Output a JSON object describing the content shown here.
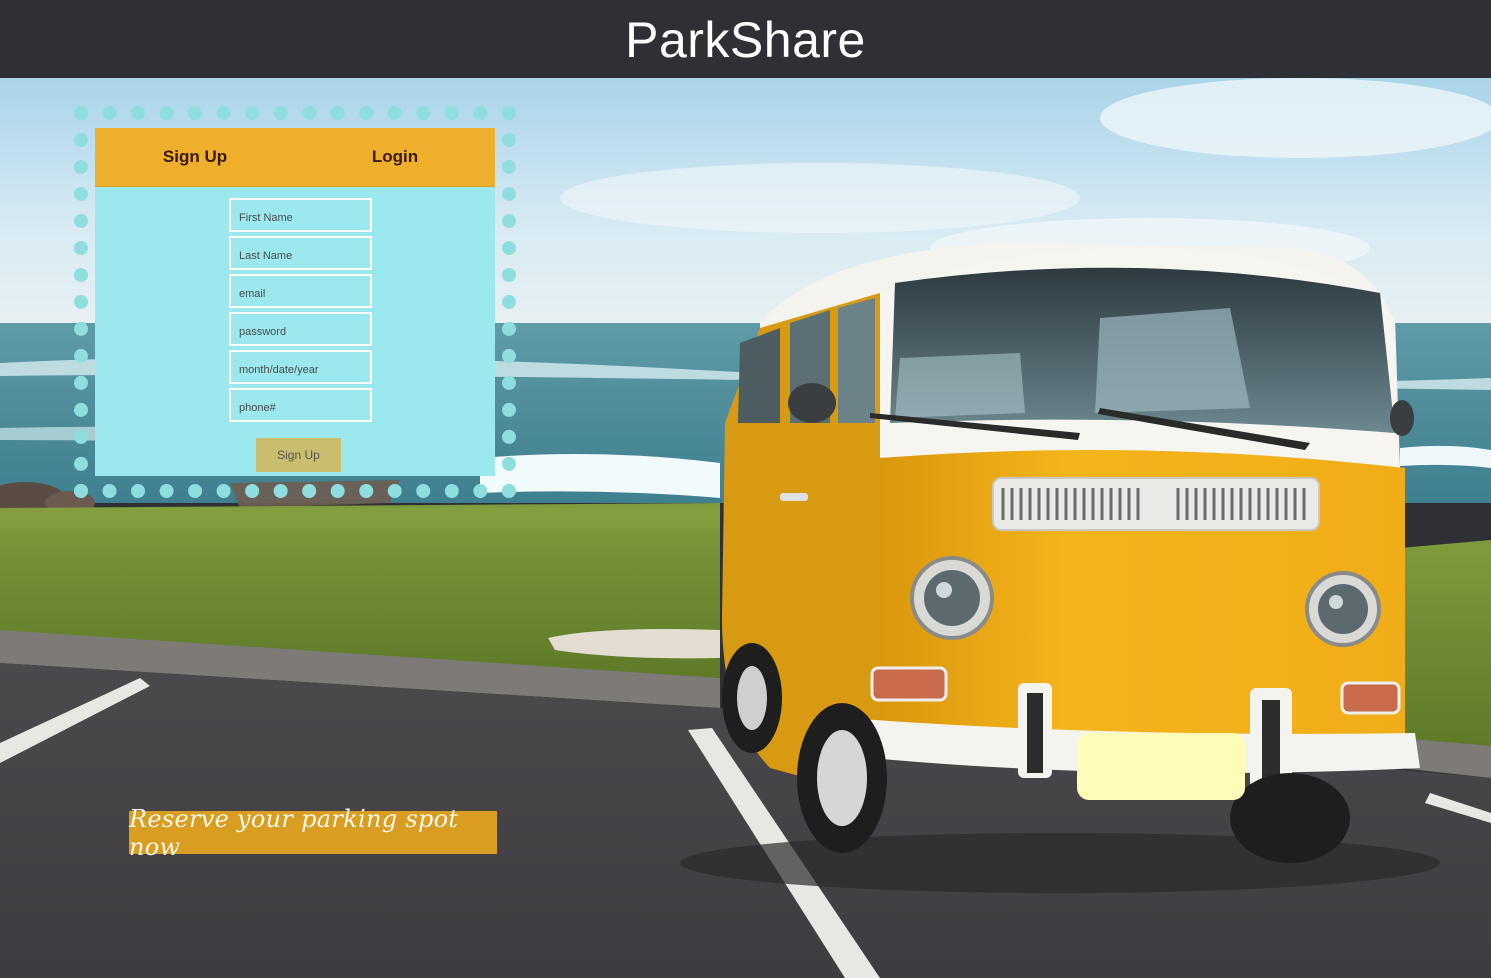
{
  "header": {
    "title": "ParkShare"
  },
  "auth": {
    "tabs": [
      {
        "label": "Sign Up"
      },
      {
        "label": "Login"
      }
    ],
    "fields": {
      "first_name": {
        "placeholder": "First Name",
        "value": ""
      },
      "last_name": {
        "placeholder": "Last Name",
        "value": ""
      },
      "email": {
        "placeholder": "email",
        "value": ""
      },
      "password": {
        "placeholder": "password",
        "value": ""
      },
      "dob": {
        "placeholder": "month/date/year",
        "value": ""
      },
      "phone": {
        "placeholder": "phone#",
        "value": ""
      }
    },
    "submit_label": "Sign Up"
  },
  "banner": {
    "text": "Reserve your parking spot now"
  },
  "colors": {
    "header_bg": "#2f3035",
    "tab_bar": "#eeb02a",
    "card_bg": "#9ce8ef",
    "dots": "#8fdedf",
    "submit_bg": "#c9bd6e",
    "banner_bg": "#d99d22",
    "van_body": "#f2b31e",
    "plate": "#fdfcb8"
  }
}
